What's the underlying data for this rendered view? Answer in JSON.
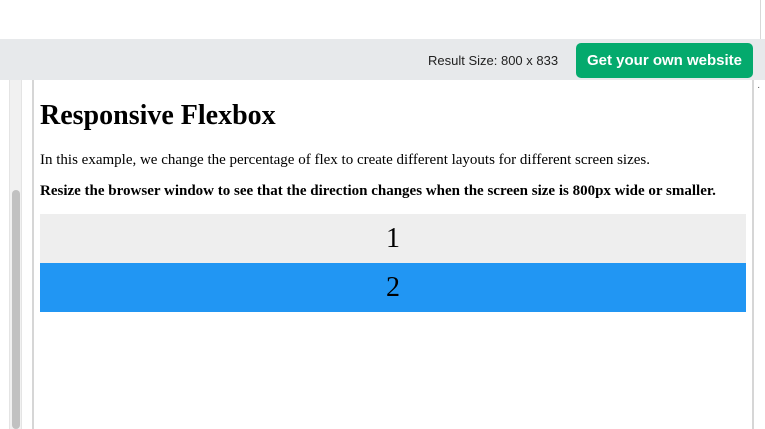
{
  "toolbar": {
    "result_size": "Result Size: 800 x 833",
    "cta_label": "Get your own website"
  },
  "page": {
    "heading": "Responsive Flexbox",
    "intro": "In this example, we change the percentage of flex to create different layouts for different screen sizes.",
    "note": "Resize the browser window to see that the direction changes when the screen size is 800px wide or smaller."
  },
  "flex_items": [
    {
      "label": "1",
      "color": "#eeeeee"
    },
    {
      "label": "2",
      "color": "#2196f3"
    }
  ],
  "colors": {
    "cta": "#04aa6d",
    "toolbar_bg": "#e7e9eb"
  }
}
